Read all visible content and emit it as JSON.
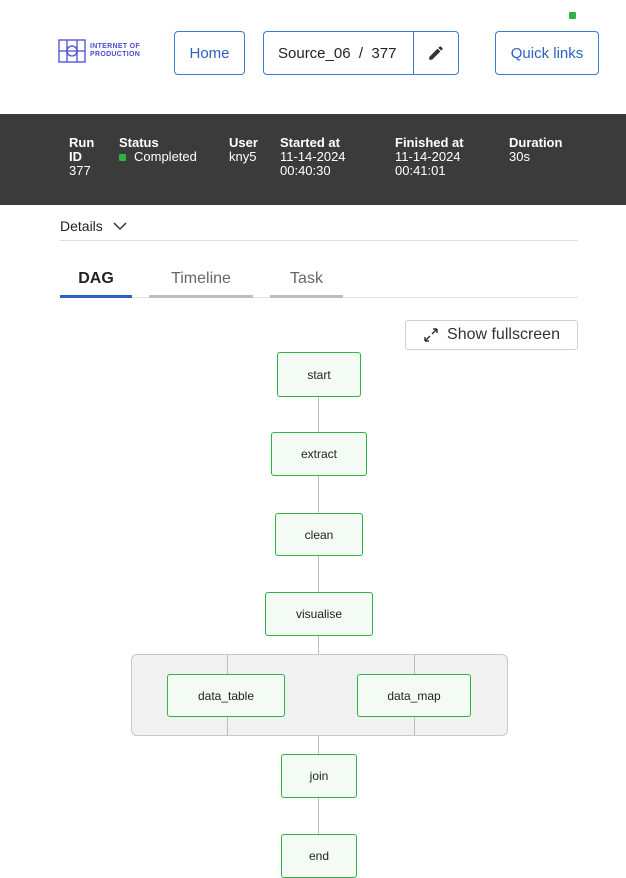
{
  "header": {
    "logo_line1": "INTERNET OF",
    "logo_line2": "PRODUCTION",
    "home_label": "Home",
    "run_selector": "Source_06  /  377",
    "quick_links_label": "Quick links",
    "status_indicator_color": "#2fb344"
  },
  "run": {
    "run_id_label_1": "Run",
    "run_id_label_2": "ID",
    "run_id": "377",
    "status_label": "Status",
    "status": "Completed",
    "user_label": "User",
    "user": "kny5",
    "started_label": "Started at",
    "started_date": "11-14-2024",
    "started_time": "00:40:30",
    "finished_label": "Finished at",
    "finished_date": "11-14-2024",
    "finished_time": "00:41:01",
    "duration_label": "Duration",
    "duration": "30s"
  },
  "details": {
    "label": "Details"
  },
  "tabs": [
    {
      "label": "DAG",
      "active": true
    },
    {
      "label": "Timeline",
      "active": false
    },
    {
      "label": "Task",
      "active": false
    }
  ],
  "fullscreen_label": "Show fullscreen",
  "dag": {
    "nodes": [
      "start",
      "extract",
      "clean",
      "visualise",
      "data_table",
      "data_map",
      "join",
      "end"
    ]
  }
}
